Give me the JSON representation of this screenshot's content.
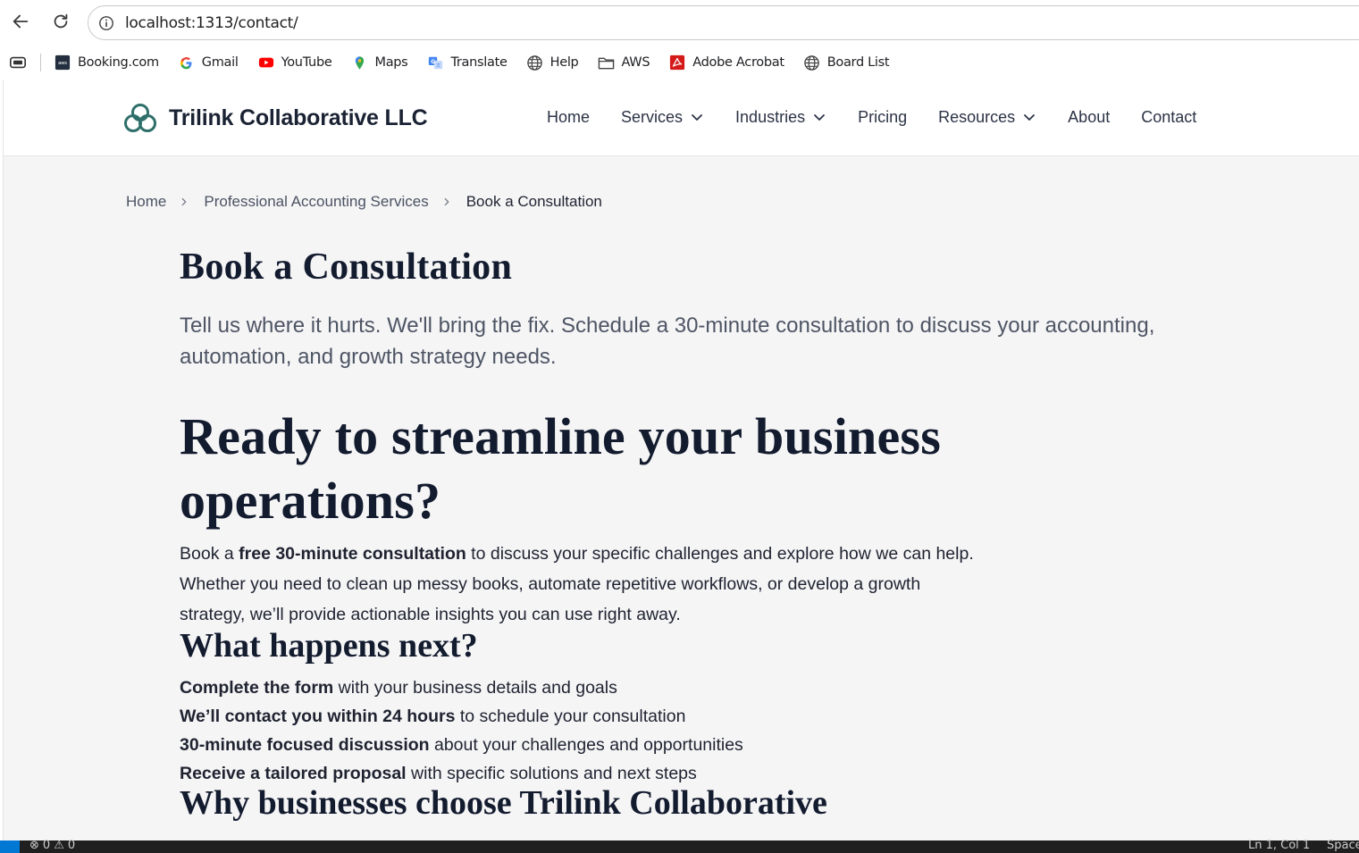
{
  "browser": {
    "url": "localhost:1313/contact/",
    "bookmarks": [
      {
        "label": "Booking.com",
        "icon": "booking-icon"
      },
      {
        "label": "Gmail",
        "icon": "google-icon"
      },
      {
        "label": "YouTube",
        "icon": "youtube-icon"
      },
      {
        "label": "Maps",
        "icon": "maps-pin-icon"
      },
      {
        "label": "Translate",
        "icon": "translate-icon"
      },
      {
        "label": "Help",
        "icon": "globe-icon"
      },
      {
        "label": "AWS",
        "icon": "folder-icon"
      },
      {
        "label": "Adobe Acrobat",
        "icon": "acrobat-icon"
      },
      {
        "label": "Board List",
        "icon": "globe-icon"
      }
    ]
  },
  "site": {
    "brand": "Trilink Collaborative LLC",
    "brand_color": "#2f6f6a",
    "nav": [
      {
        "label": "Home",
        "dropdown": false
      },
      {
        "label": "Services",
        "dropdown": true
      },
      {
        "label": "Industries",
        "dropdown": true
      },
      {
        "label": "Pricing",
        "dropdown": false
      },
      {
        "label": "Resources",
        "dropdown": true
      },
      {
        "label": "About",
        "dropdown": false
      },
      {
        "label": "Contact",
        "dropdown": false
      }
    ]
  },
  "breadcrumb": [
    "Home",
    "Professional Accounting Services",
    "Book a Consultation"
  ],
  "main": {
    "title": "Book a Consultation",
    "lead": "Tell us where it hurts. We'll bring the fix. Schedule a 30-minute consultation to discuss your accounting, automation, and growth strategy needs.",
    "heading": "Ready to streamline your business operations?",
    "intro_pre": "Book a ",
    "intro_bold": "free 30-minute consultation",
    "intro_post": " to discuss your specific challenges and explore how we can help. Whether you need to clean up messy books, automate repetitive workflows, or develop a growth strategy, we’ll provide actionable insights you can use right away.",
    "next_heading": "What happens next?",
    "steps": [
      {
        "bold": "Complete the form",
        "text": " with your business details and goals"
      },
      {
        "bold": "We’ll contact you within 24 hours",
        "text": " to schedule your consultation"
      },
      {
        "bold": "30-minute focused discussion",
        "text": " about your challenges and opportunities"
      },
      {
        "bold": "Receive a tailored proposal",
        "text": " with specific solutions and next steps"
      }
    ],
    "why_heading": "Why businesses choose Trilink Collaborative"
  },
  "statusbar": {
    "errors": "0",
    "warnings": "0",
    "position": "Ln 1, Col 1",
    "spaces": "Spaces"
  }
}
